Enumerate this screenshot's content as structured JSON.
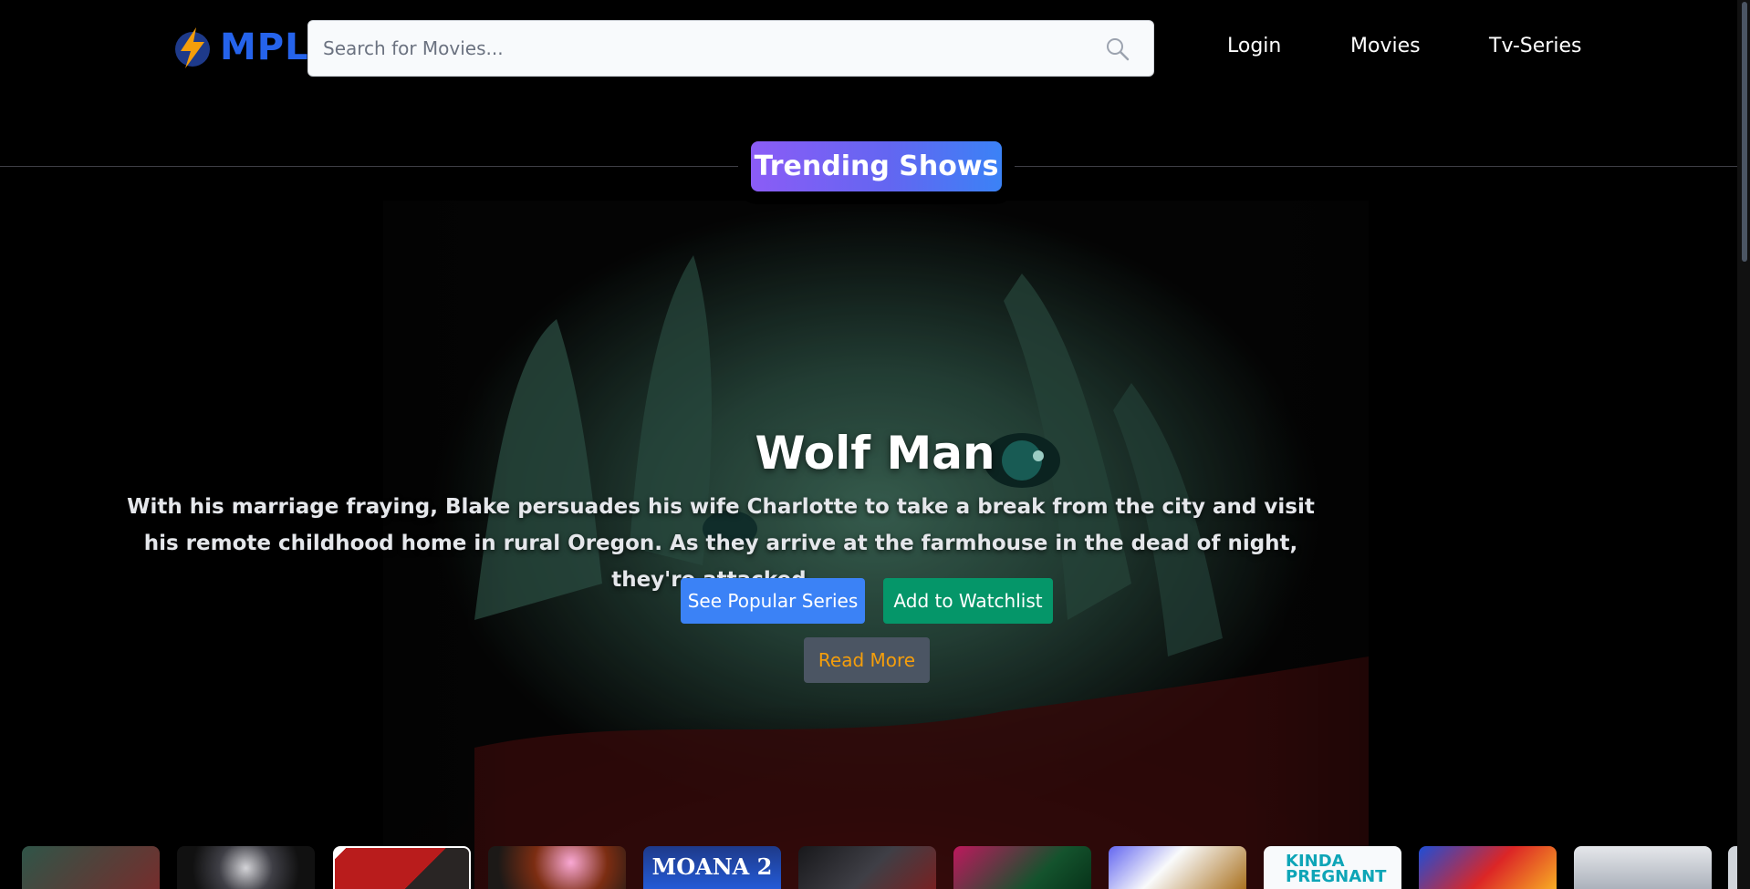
{
  "header": {
    "logo_text": "MPL",
    "search_placeholder": "Search for Movies...",
    "nav": {
      "login": "Login",
      "movies": "Movies",
      "tv_series": "Tv-Series"
    }
  },
  "section": {
    "title": "Trending Shows"
  },
  "hero": {
    "title": "Wolf Man",
    "description": "With his marriage fraying, Blake persuades his wife Charlotte to take a break from the city and visit his remote childhood home in rural Oregon. As they arrive at the farmhouse in the dead of night, they're attacked...",
    "buttons": {
      "popular": "See Popular Series",
      "watchlist": "Add to Watchlist",
      "read_more": "Read More"
    }
  },
  "thumbnails": [
    {
      "label": ""
    },
    {
      "label": ""
    },
    {
      "label": ""
    },
    {
      "label": ""
    },
    {
      "label": "MOANA 2"
    },
    {
      "label": ""
    },
    {
      "label": ""
    },
    {
      "label": ""
    },
    {
      "label": "KINDA PREGNANT"
    },
    {
      "label": ""
    },
    {
      "label": ""
    }
  ],
  "colors": {
    "brand": "#2563eb",
    "accent_purple": "#8b5cf6",
    "accent_blue": "#3b82f6",
    "watchlist_green": "#059669",
    "read_more_text": "#f59e0b"
  }
}
